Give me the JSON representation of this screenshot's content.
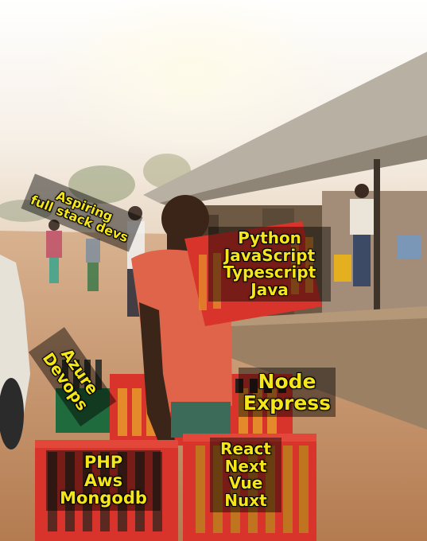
{
  "meme": {
    "aspiring_label": [
      "Aspiring",
      "full stack devs"
    ],
    "backend_languages": [
      "Python",
      "JavaScript",
      "Typescript",
      "Java"
    ],
    "cloud_tools": [
      "Azure",
      "Devops"
    ],
    "runtime": [
      "Node",
      "Express"
    ],
    "frontend_frameworks": [
      "React",
      "Next",
      "Vue",
      "Nuxt"
    ],
    "php_stack": [
      "PHP",
      "Aws",
      "Mongodb"
    ]
  },
  "colors": {
    "label_text": "#f5e61a",
    "crate_red": "#d9342b",
    "shirt": "#e0644a",
    "road": "#c08a5c"
  }
}
